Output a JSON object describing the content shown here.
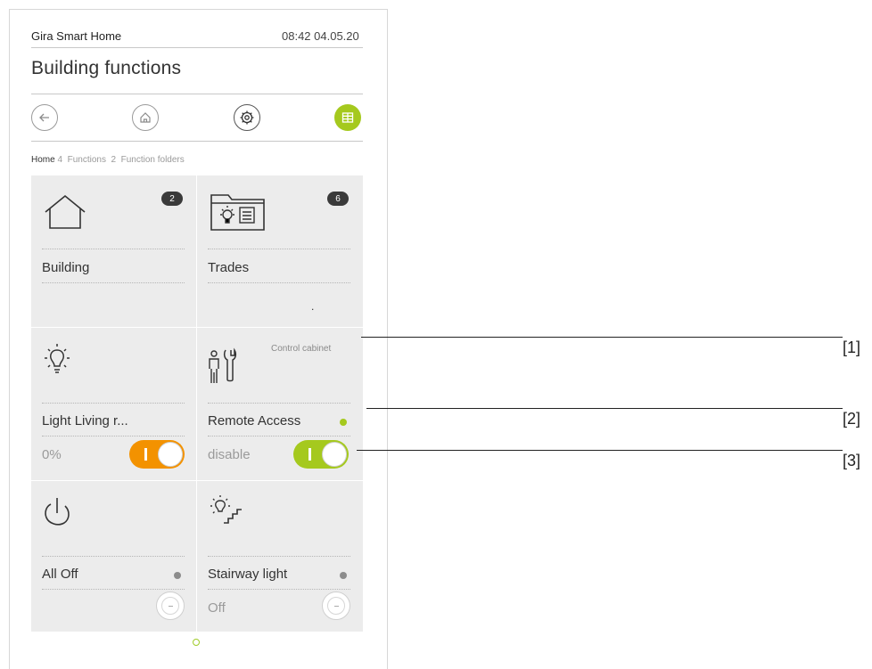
{
  "header": {
    "app_name": "Gira Smart Home",
    "datetime": "08:42 04.05.20"
  },
  "page_title": "Building functions",
  "nav": {
    "back_icon": "arrow-left-icon",
    "home_icon": "home-icon",
    "settings_icon": "gear-icon",
    "grid_icon": "grid-icon",
    "active_color": "#a5c91e"
  },
  "breadcrumb": {
    "home": "Home",
    "rest": " 4  Functions  2  Function folders"
  },
  "tiles": {
    "building": {
      "label": "Building",
      "badge": "2",
      "icon": "house-icon"
    },
    "trades": {
      "label": "Trades",
      "badge": "6",
      "icon": "trades-folder-icon",
      "dot": "."
    },
    "light": {
      "label": "Light Living r...",
      "value": "0%",
      "icon": "bulb-icon",
      "toggle_color": "#f39200"
    },
    "remote": {
      "label": "Remote Access",
      "note": "Control cabinet",
      "value": "disable",
      "icon": "person-wrench-icon",
      "led_color": "#a5c91e",
      "toggle_color": "#a5c91e"
    },
    "alloff": {
      "label": "All Off",
      "icon": "power-icon",
      "led_color": "#8c8c8c"
    },
    "stairway": {
      "label": "Stairway light",
      "value": "Off",
      "icon": "stair-light-icon",
      "led_color": "#8c8c8c"
    }
  },
  "callouts": [
    "[1]",
    "[2]",
    "[3]"
  ]
}
